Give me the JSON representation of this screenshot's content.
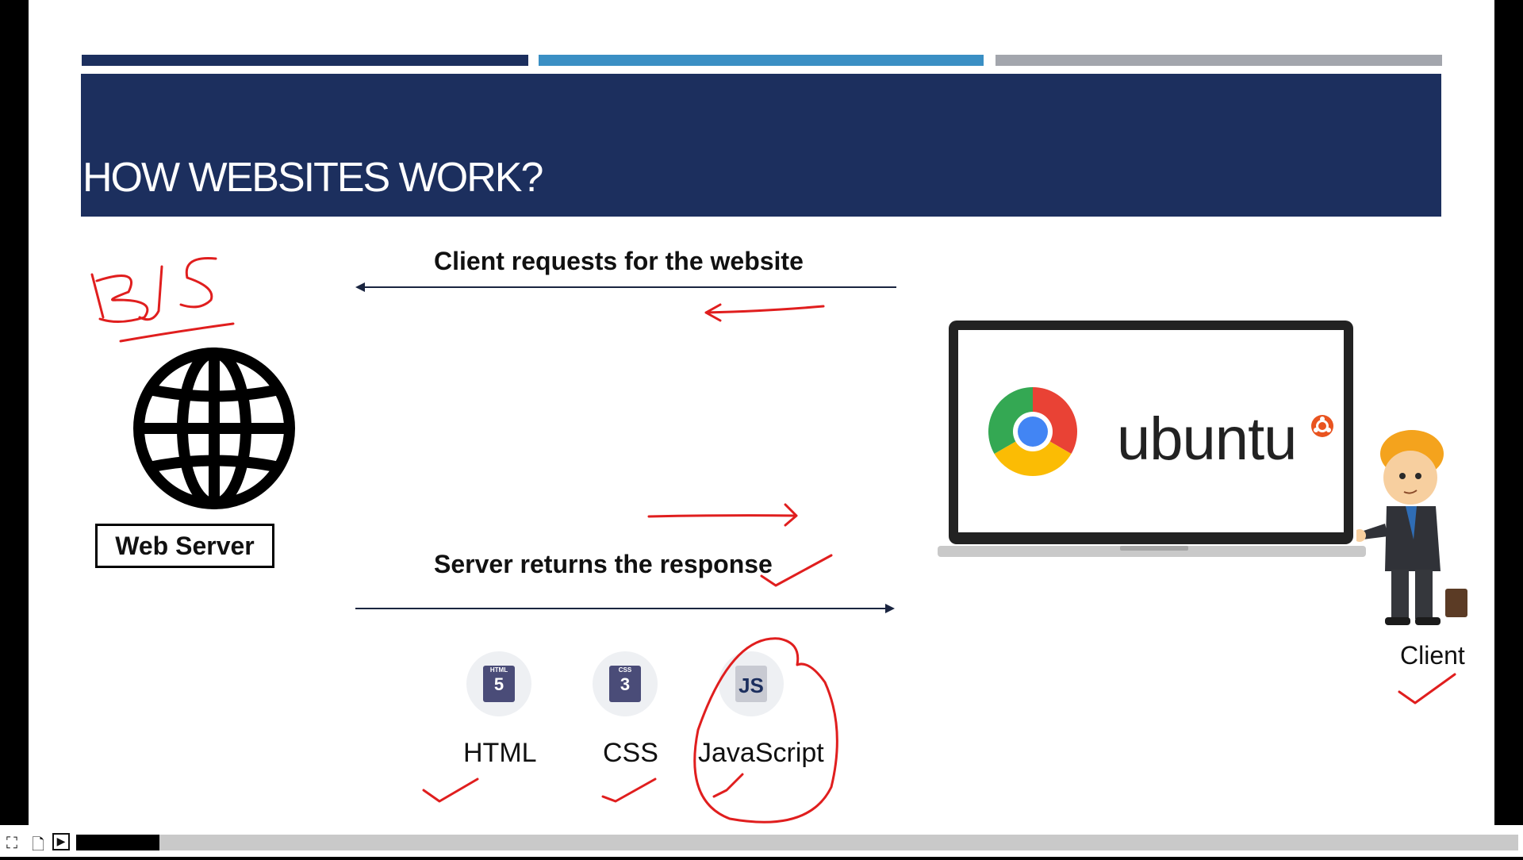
{
  "slide": {
    "title": "HOW WEBSITES WORK?",
    "request_caption": "Client requests for the website",
    "response_caption": "Server returns the response",
    "server_label": "Web Server",
    "client_label": "Client",
    "os_text": "ubuntu",
    "annotation": "BJS",
    "technologies": [
      {
        "label": "HTML",
        "badge": "5",
        "badge_caption": "HTML"
      },
      {
        "label": "CSS",
        "badge": "3",
        "badge_caption": "CSS"
      },
      {
        "label": "JavaScript",
        "badge": "JS",
        "badge_caption": ""
      }
    ],
    "bar_colors": [
      "#1c2f5e",
      "#3a8fc4",
      "#a3a6ad"
    ],
    "ink_color": "#e01e1e"
  },
  "player": {
    "progress": 0.058,
    "icons": [
      "fullscreen-icon",
      "page-icon",
      "play-icon"
    ]
  }
}
